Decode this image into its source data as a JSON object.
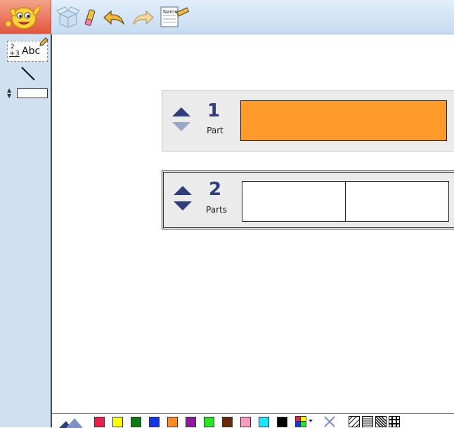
{
  "colors": {
    "toolbar_bg": "#c6dbf1",
    "sidebar_bg": "#cfe0f1",
    "bar_fill_orange": "#ff9a2b",
    "arrow_active": "#2f3d7c",
    "arrow_inactive": "#9aa7c7"
  },
  "toolbar": {
    "notepad_label": "Name"
  },
  "sidebar": {
    "fraction_tool": {
      "numerator": "2",
      "plus": "+3",
      "abc": "Abc"
    }
  },
  "bars": [
    {
      "count": "1",
      "label": "Part",
      "parts": 1,
      "filled": [
        true
      ],
      "up_active": true,
      "down_active": false
    },
    {
      "count": "2",
      "label": "Parts",
      "parts": 2,
      "filled": [
        false,
        false
      ],
      "up_active": true,
      "down_active": true
    }
  ],
  "palette": {
    "colors": [
      "#e8204a",
      "#ffff00",
      "#0d7a14",
      "#1336e8",
      "#ff8a1f",
      "#8c1a9c",
      "#26e626",
      "#6a2a0a",
      "#ff99c0",
      "#1ee6ff",
      "#000000"
    ],
    "icons": [
      "multicolor-icon",
      "clear-x-icon",
      "hatch-diagonal-icon",
      "hatch-horizontal-icon",
      "hatch-dense-icon",
      "hatch-grid-icon"
    ]
  }
}
